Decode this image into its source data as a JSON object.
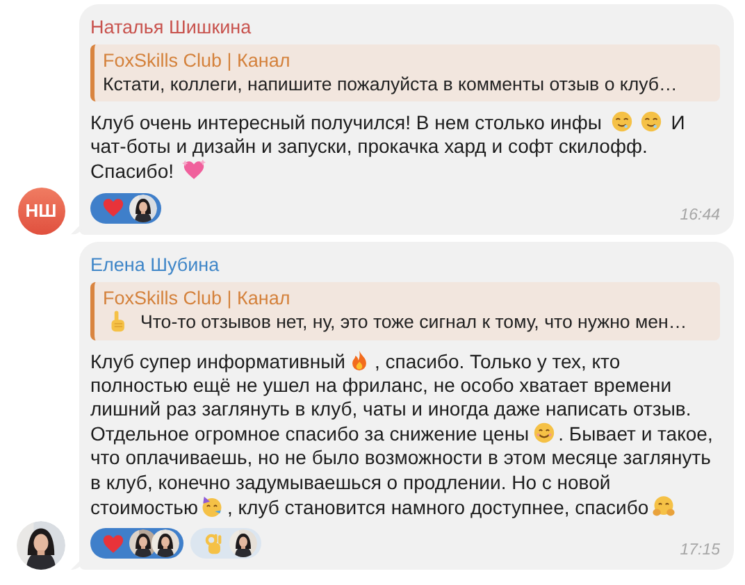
{
  "messages": [
    {
      "author": "Наталья Шишкина",
      "color": "#c8524d",
      "avatar": {
        "kind": "initials",
        "text": "НШ"
      },
      "reply": {
        "title": "FoxSkills Club | Канал",
        "segments": [
          {
            "kind": "text",
            "text": "Кстати, коллеги, напишите пожалуйста в комменты отзыв о клуб…"
          }
        ]
      },
      "segments": [
        {
          "kind": "text",
          "text": "Клуб очень интересный получился! В нем столько инфы "
        },
        {
          "kind": "blush"
        },
        {
          "kind": "blush"
        },
        {
          "kind": "text",
          "text": " И чат-боты и дизайн и запуски, прокачка хард и софт скилофф. Спасибо! "
        },
        {
          "kind": "sparkleheart"
        }
      ],
      "reactions": [
        {
          "kind": "heart",
          "selected": true
        }
      ],
      "time": "16:44"
    },
    {
      "author": "Елена Шубина",
      "color": "#3f86c8",
      "reply": {
        "title": "FoxSkills Club | Канал",
        "segments": [
          {
            "kind": "point"
          },
          {
            "kind": "text",
            "text": "Что-то отзывов нет, ну, это тоже сигнал к тому, что нужно мен…"
          }
        ]
      },
      "segments": [
        {
          "kind": "text",
          "text": "Клуб супер информативный"
        },
        {
          "kind": "fire"
        },
        {
          "kind": "text",
          "text": ", спасибо. Только у тех, кто полностью ещё не ушел на фриланс, не особо хватает времени лишний раз заглянуть в клуб, чаты и иногда даже написать отзыв. Отдельное огромное спасибо за снижение цены"
        },
        {
          "kind": "smile"
        },
        {
          "kind": "text",
          "text": ". Бывает и такое, что оплачиваешь, но не было возможности в этом месяце заглянуть в клуб, конечно задумываешься о продлении. Но с новой стоимостью"
        },
        {
          "kind": "party"
        },
        {
          "kind": "text",
          "text": ", клуб становится намного доступнее, спасибо"
        },
        {
          "kind": "hug"
        }
      ],
      "reactions": [
        {
          "kind": "heart",
          "selected": true
        },
        {
          "kind": "ok",
          "selected": false
        }
      ],
      "time": "17:15"
    }
  ]
}
